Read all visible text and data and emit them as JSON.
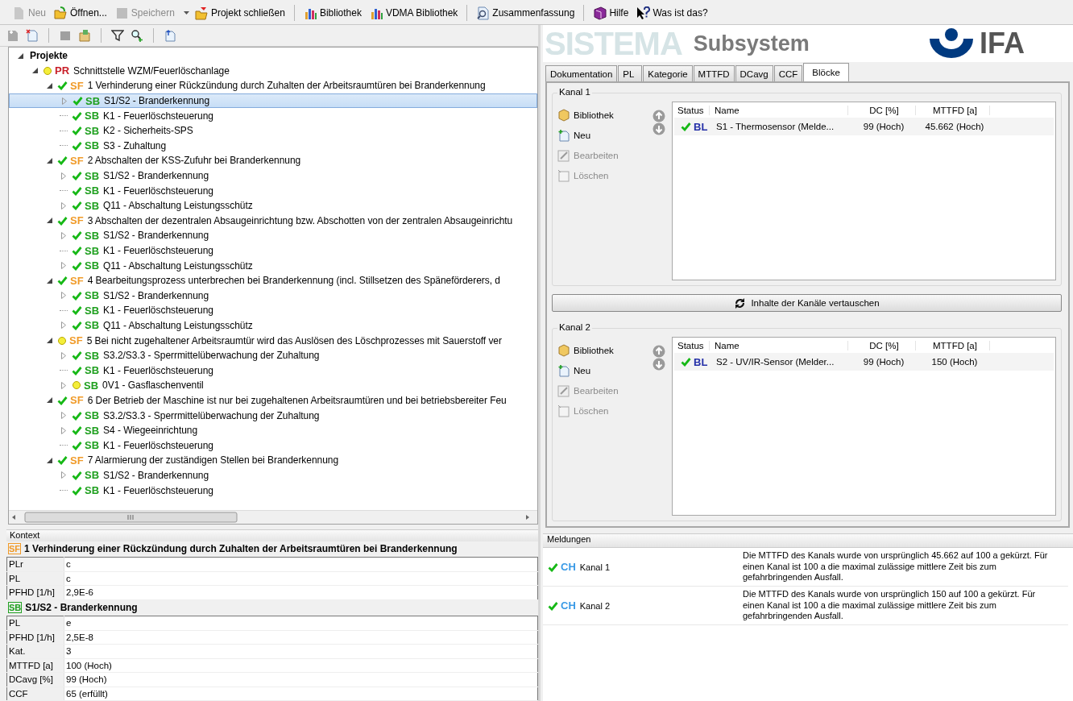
{
  "toolbar": {
    "groups": [
      {
        "items": [
          {
            "label": "Neu",
            "disabled": true,
            "dropdown": false
          },
          {
            "label": "Öffnen...",
            "disabled": false,
            "dropdown": false
          },
          {
            "label": "Speichern",
            "disabled": true,
            "dropdown": true
          },
          {
            "label": "Projekt schließen",
            "disabled": false,
            "dropdown": false
          }
        ]
      },
      {
        "items": [
          {
            "label": "Bibliothek",
            "disabled": false,
            "dropdown": false
          },
          {
            "label": "VDMA Bibliothek",
            "disabled": false,
            "dropdown": false
          }
        ]
      },
      {
        "items": [
          {
            "label": "Zusammenfassung",
            "disabled": false,
            "dropdown": false
          }
        ]
      },
      {
        "items": [
          {
            "label": "Hilfe",
            "disabled": false,
            "dropdown": false
          },
          {
            "label": "Was ist das?",
            "disabled": false,
            "dropdown": false
          }
        ]
      }
    ]
  },
  "tree": {
    "label": "Projekte",
    "expanded": true,
    "children": [
      {
        "kind": "project",
        "ok": false,
        "tag": "PR",
        "label": "Schnittstelle WZM/Feuerlöschanlage",
        "expanded": true,
        "selected": false,
        "children": [
          {
            "kind": "function",
            "ok": true,
            "tag": "SF",
            "label": "1 Verhinderung einer Rückzündung durch Zuhalten der Arbeitsraumtüren bei Branderkennung",
            "expanded": true,
            "selected": false,
            "children": [
              {
                "kind": "subsystem",
                "ok": true,
                "tag": "SB",
                "label": "S1/S2 - Branderkennung",
                "expandable": true,
                "selected": true
              },
              {
                "kind": "subsystem",
                "ok": true,
                "tag": "SB",
                "label": "K1 - Feuerlöschsteuerung",
                "expandable": false,
                "selected": false
              },
              {
                "kind": "subsystem",
                "ok": true,
                "tag": "SB",
                "label": "K2 - Sicherheits-SPS",
                "expandable": false,
                "selected": false
              },
              {
                "kind": "subsystem",
                "ok": true,
                "tag": "SB",
                "label": "S3 - Zuhaltung",
                "expandable": false,
                "selected": false
              }
            ]
          },
          {
            "kind": "function",
            "ok": true,
            "tag": "SF",
            "label": "2 Abschalten der KSS-Zufuhr bei Branderkennung",
            "expanded": true,
            "selected": false,
            "children": [
              {
                "kind": "subsystem",
                "ok": true,
                "tag": "SB",
                "label": "S1/S2 - Branderkennung",
                "expandable": true,
                "selected": false
              },
              {
                "kind": "subsystem",
                "ok": true,
                "tag": "SB",
                "label": "K1 - Feuerlöschsteuerung",
                "expandable": false,
                "selected": false
              },
              {
                "kind": "subsystem",
                "ok": true,
                "tag": "SB",
                "label": "Q11 - Abschaltung Leistungsschütz",
                "expandable": true,
                "selected": false
              }
            ]
          },
          {
            "kind": "function",
            "ok": true,
            "tag": "SF",
            "label": "3 Abschalten der dezentralen Absaugeinrichtung bzw. Abschotten von der zentralen Absaugeinrichtu",
            "expanded": true,
            "selected": false,
            "children": [
              {
                "kind": "subsystem",
                "ok": true,
                "tag": "SB",
                "label": "S1/S2 - Branderkennung",
                "expandable": true,
                "selected": false
              },
              {
                "kind": "subsystem",
                "ok": true,
                "tag": "SB",
                "label": "K1 - Feuerlöschsteuerung",
                "expandable": false,
                "selected": false
              },
              {
                "kind": "subsystem",
                "ok": true,
                "tag": "SB",
                "label": "Q11 - Abschaltung Leistungsschütz",
                "expandable": true,
                "selected": false
              }
            ]
          },
          {
            "kind": "function",
            "ok": true,
            "tag": "SF",
            "label": "4 Bearbeitungsprozess unterbrechen bei Branderkennung (incl. Stillsetzen des Späneförderers, d",
            "expanded": true,
            "selected": false,
            "children": [
              {
                "kind": "subsystem",
                "ok": true,
                "tag": "SB",
                "label": "S1/S2 - Branderkennung",
                "expandable": true,
                "selected": false
              },
              {
                "kind": "subsystem",
                "ok": true,
                "tag": "SB",
                "label": "K1 - Feuerlöschsteuerung",
                "expandable": false,
                "selected": false
              },
              {
                "kind": "subsystem",
                "ok": true,
                "tag": "SB",
                "label": "Q11 - Abschaltung Leistungsschütz",
                "expandable": true,
                "selected": false
              }
            ]
          },
          {
            "kind": "function",
            "ok": false,
            "tag": "SF",
            "label": "5 Bei nicht zugehaltener Arbeitsraumtür wird das Auslösen des Löschprozesses mit Sauerstoff ver",
            "expanded": true,
            "selected": false,
            "children": [
              {
                "kind": "subsystem",
                "ok": true,
                "tag": "SB",
                "label": "S3.2/S3.3 - Sperrmittelüberwachung der Zuhaltung",
                "expandable": true,
                "selected": false
              },
              {
                "kind": "subsystem",
                "ok": true,
                "tag": "SB",
                "label": "K1 - Feuerlöschsteuerung",
                "expandable": false,
                "selected": false
              },
              {
                "kind": "subsystem",
                "ok": false,
                "tag": "SB",
                "label": "0V1 - Gasflaschenventil",
                "expandable": true,
                "selected": false
              }
            ]
          },
          {
            "kind": "function",
            "ok": true,
            "tag": "SF",
            "label": "6 Der Betrieb der Maschine ist nur bei zugehaltenen Arbeitsraumtüren und bei betriebsbereiter Feu",
            "expanded": true,
            "selected": false,
            "children": [
              {
                "kind": "subsystem",
                "ok": true,
                "tag": "SB",
                "label": "S3.2/S3.3 - Sperrmittelüberwachung der Zuhaltung",
                "expandable": true,
                "selected": false
              },
              {
                "kind": "subsystem",
                "ok": true,
                "tag": "SB",
                "label": "S4 - Wiegeeinrichtung",
                "expandable": true,
                "selected": false
              },
              {
                "kind": "subsystem",
                "ok": true,
                "tag": "SB",
                "label": "K1 - Feuerlöschsteuerung",
                "expandable": false,
                "selected": false
              }
            ]
          },
          {
            "kind": "function",
            "ok": true,
            "tag": "SF",
            "label": "7 Alarmierung der zuständigen Stellen bei Branderkennung",
            "expanded": true,
            "selected": false,
            "children": [
              {
                "kind": "subsystem",
                "ok": true,
                "tag": "SB",
                "label": "S1/S2 - Branderkennung",
                "expandable": true,
                "selected": false
              },
              {
                "kind": "subsystem",
                "ok": true,
                "tag": "SB",
                "label": "K1 - Feuerlöschsteuerung",
                "expandable": false,
                "selected": false
              }
            ]
          }
        ]
      }
    ]
  },
  "context": {
    "title": "Kontext",
    "sections": [
      {
        "kind": "function",
        "tag": "SF",
        "title": "1 Verhinderung einer Rückzündung durch Zuhalten der Arbeitsraumtüren bei Branderkennung",
        "rows": [
          {
            "label": "PLr",
            "value": "c"
          },
          {
            "label": "PL",
            "value": "c"
          },
          {
            "label": "PFHD [1/h]",
            "value": "2,9E-6"
          }
        ]
      },
      {
        "kind": "subsystem",
        "tag": "SB",
        "title": "S1/S2 - Branderkennung",
        "rows": [
          {
            "label": "PL",
            "value": "e"
          },
          {
            "label": "PFHD [1/h]",
            "value": "2,5E-8"
          },
          {
            "label": "Kat.",
            "value": "3"
          },
          {
            "label": "MTTFD [a]",
            "value": "100 (Hoch)"
          },
          {
            "label": "DCavg [%]",
            "value": "99 (Hoch)"
          },
          {
            "label": "CCF",
            "value": "65 (erfüllt)"
          }
        ]
      }
    ]
  },
  "header": {
    "watermark": "SISTEMA",
    "title": "Subsystem",
    "logo_text": "IFA"
  },
  "tabs": [
    {
      "label": "Dokumentation",
      "selected": false
    },
    {
      "label": "PL",
      "selected": false
    },
    {
      "label": "Kategorie",
      "selected": false
    },
    {
      "label": "MTTFD",
      "selected": false
    },
    {
      "label": "DCavg",
      "selected": false
    },
    {
      "label": "CCF",
      "selected": false
    },
    {
      "label": "Blöcke",
      "selected": true
    }
  ],
  "channels": [
    {
      "title": "Kanal 1",
      "actions": [
        {
          "label": "Bibliothek",
          "disabled": false
        },
        {
          "label": "Neu",
          "disabled": false
        },
        {
          "label": "Bearbeiten",
          "disabled": true
        },
        {
          "label": "Löschen",
          "disabled": true
        }
      ],
      "columns": [
        "Status",
        "Name",
        "DC [%]",
        "MTTFD [a]"
      ],
      "rows": [
        {
          "ok": true,
          "tag": "BL",
          "name": "S1 - Thermosensor (Melde...",
          "dc": "99 (Hoch)",
          "mttfd": "45.662 (Hoch)"
        }
      ]
    },
    {
      "title": "Kanal 2",
      "actions": [
        {
          "label": "Bibliothek",
          "disabled": false
        },
        {
          "label": "Neu",
          "disabled": false
        },
        {
          "label": "Bearbeiten",
          "disabled": true
        },
        {
          "label": "Löschen",
          "disabled": true
        }
      ],
      "columns": [
        "Status",
        "Name",
        "DC [%]",
        "MTTFD [a]"
      ],
      "rows": [
        {
          "ok": true,
          "tag": "BL",
          "name": "S2 - UV/IR-Sensor (Melder...",
          "dc": "99 (Hoch)",
          "mttfd": "150 (Hoch)"
        }
      ]
    }
  ],
  "swap_button": {
    "label": "Inhalte der Kanäle vertauschen"
  },
  "messages": {
    "title": "Meldungen",
    "items": [
      {
        "ok": true,
        "tag": "CH",
        "label": "Kanal 1",
        "text": "Die MTTFD des Kanals wurde von ursprünglich 45.662 auf 100 a gekürzt. Für einen Kanal ist 100 a die maximal zulässige mittlere Zeit bis zum gefahrbringenden Ausfall."
      },
      {
        "ok": true,
        "tag": "CH",
        "label": "Kanal 2",
        "text": "Die MTTFD des Kanals wurde von ursprünglich 150 auf 100 a gekürzt. Für einen Kanal ist 100 a die maximal zulässige mittlere Zeit bis zum gefahrbringenden Ausfall."
      }
    ]
  }
}
